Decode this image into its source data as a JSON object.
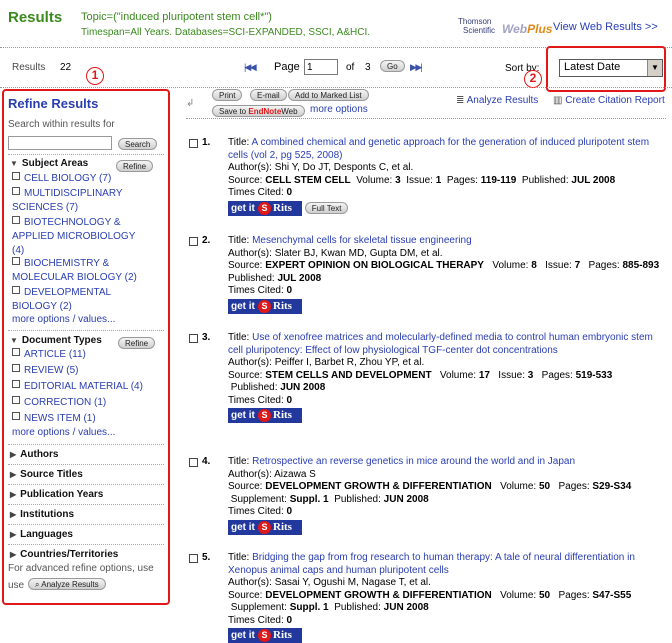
{
  "header": {
    "title": "Results",
    "topic": "Topic=(\"induced pluripotent stem cell*\")",
    "timespan": "Timespan=All Years. Databases=SCI-EXPANDED, SSCI, A&HCI.",
    "logo_line1": "Thomson",
    "logo_line2": "Scientific",
    "logo_web": "Web",
    "logo_plus": "Plus",
    "view_web": "View Web Results >>"
  },
  "results_bar": {
    "results_label": "Results",
    "results_count": "22",
    "page_label": "Page",
    "page_value": "1",
    "of_label": "of",
    "total_pages": "3",
    "go_label": "Go",
    "first_glyph": "|◀ ◀",
    "last_glyph": "▶ ▶|",
    "sort_label": "Sort by:",
    "sort_value": "Latest Date"
  },
  "annotations": {
    "marker1": "1",
    "marker2": "2"
  },
  "refine": {
    "title": "Refine Results",
    "search_label": "Search within results for",
    "search_button": "Search",
    "refine_button": "Refine",
    "subject_areas": {
      "heading": "Subject Areas",
      "items": [
        {
          "label": "CELL BIOLOGY",
          "count": "(7)"
        },
        {
          "label": "MULTIDISCIPLINARY SCIENCES",
          "count": "(7)"
        },
        {
          "label": "BIOTECHNOLOGY & APPLIED MICROBIOLOGY",
          "count": "(4)"
        },
        {
          "label": "BIOCHEMISTRY & MOLECULAR BIOLOGY",
          "count": "(2)"
        },
        {
          "label": "DEVELOPMENTAL BIOLOGY",
          "count": "(2)"
        }
      ],
      "more": "more options / values..."
    },
    "document_types": {
      "heading": "Document Types",
      "items": [
        {
          "label": "ARTICLE",
          "count": "(11)"
        },
        {
          "label": "REVIEW",
          "count": "(5)"
        },
        {
          "label": "EDITORIAL MATERIAL",
          "count": "(4)"
        },
        {
          "label": "CORRECTION",
          "count": "(1)"
        },
        {
          "label": "NEWS ITEM",
          "count": "(1)"
        }
      ],
      "more": "more options / values..."
    },
    "collapsed": [
      "Authors",
      "Source Titles",
      "Publication Years",
      "Institutions",
      "Languages",
      "Countries/Territories"
    ],
    "advanced_text": "For advanced refine options, use",
    "analyze_button": "Analyze Results"
  },
  "toolbar": {
    "print": "Print",
    "email": "E-mail",
    "mark": "Add to Marked List",
    "save_to": "Save to",
    "endnote": "EndNote",
    "web": "Web",
    "more_options": "more options",
    "analyze": "Analyze Results",
    "citation": "Create Citation Report"
  },
  "labels": {
    "title": "Title:",
    "authors": "Author(s):",
    "source": "Source:",
    "volume": "Volume:",
    "issue": "Issue:",
    "pages": "Pages:",
    "published": "Published:",
    "supplement": "Supplement:",
    "times_cited": "Times Cited:",
    "getit": "get it",
    "rits": "Rits",
    "full_text": "Full Text"
  },
  "records": [
    {
      "num": "1.",
      "title": "A combined chemical and genetic approach for the generation of induced pluripotent stem cells (vol 2, pg 525, 2008)",
      "authors": "Shi Y, Do JT, Desponts C, et al.",
      "source": "CELL STEM CELL",
      "volume": "3",
      "issue": "1",
      "pages": "119-119",
      "published": "JUL 2008",
      "times_cited": "0"
    },
    {
      "num": "2.",
      "title": "Mesenchymal cells for skeletal tissue engineering",
      "authors": "Slater BJ, Kwan MD, Gupta DM, et al.",
      "source": "EXPERT OPINION ON BIOLOGICAL THERAPY",
      "volume": "8",
      "issue": "7",
      "pages": "885-893",
      "published": "JUL 2008",
      "times_cited": "0"
    },
    {
      "num": "3.",
      "title": "Use of xenofree matrices and molecularly-defined media to control human embryonic stem cell pluripotency: Effect of low physiological TGF-center dot concentrations",
      "authors": "Peiffer I, Barbet R, Zhou YP, et al.",
      "source": "STEM CELLS AND DEVELOPMENT",
      "volume": "17",
      "issue": "3",
      "pages": "519-533",
      "published": "JUN 2008",
      "times_cited": "0"
    },
    {
      "num": "4.",
      "title": "Retrospective an reverse genetics in mice around the world and in Japan",
      "authors": "Aizawa S",
      "source": "DEVELOPMENT GROWTH & DIFFERENTIATION",
      "volume": "50",
      "pages": "S29-S34",
      "supplement": "Suppl. 1",
      "published": "JUN 2008",
      "times_cited": "0"
    },
    {
      "num": "5.",
      "title": "Bridging the gap from frog research to human therapy: A tale of neural differentiation in Xenopus animal caps and human pluripotent cells",
      "authors": "Sasai Y, Ogushi M, Nagase T, et al.",
      "source": "DEVELOPMENT GROWTH & DIFFERENTIATION",
      "volume": "50",
      "pages": "S47-S55",
      "supplement": "Suppl. 1",
      "published": "JUN 2008",
      "times_cited": "0"
    }
  ],
  "colors": {
    "title_green": "#3b8a1e",
    "link_blue": "#2a3eb1",
    "highlight_red": "#e01818",
    "rits_blue": "#23389c"
  }
}
